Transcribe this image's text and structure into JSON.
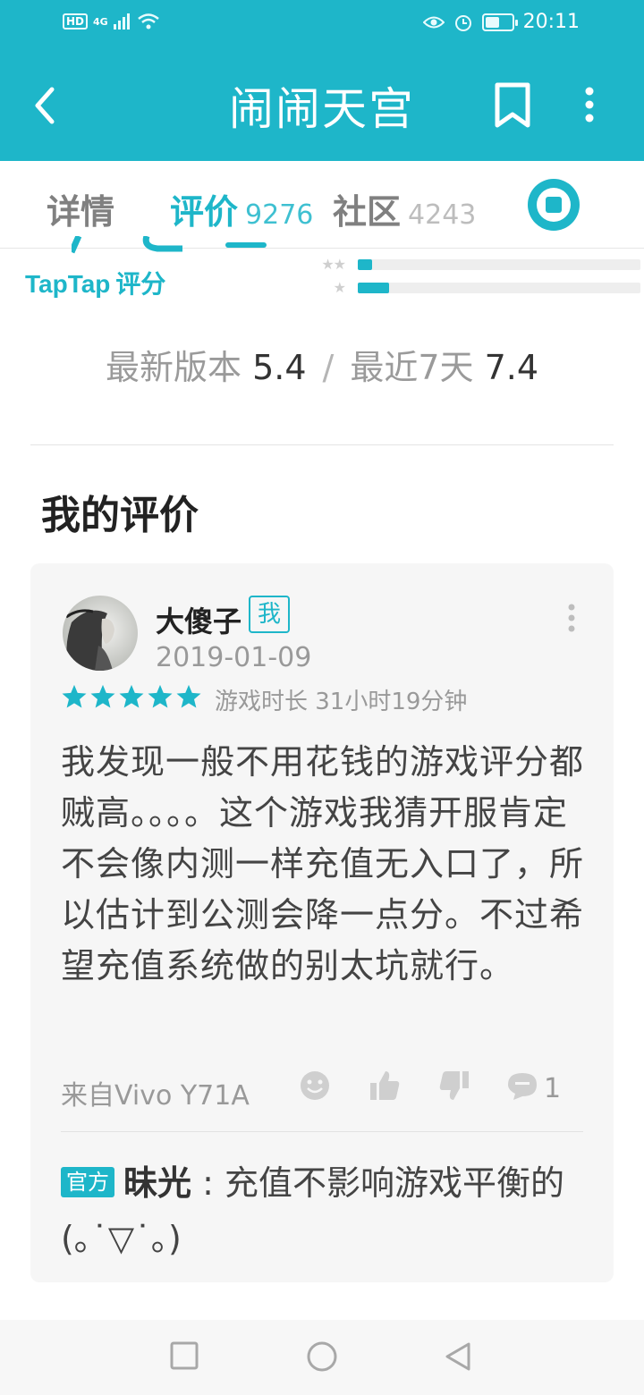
{
  "status_bar": {
    "hd_label": "HD",
    "network_label": "4G",
    "time": "20:11",
    "battery_level": 0.55
  },
  "header": {
    "title": "闹闹天宫",
    "back_icon": "chevron-left-icon",
    "bookmark_icon": "bookmark-icon",
    "more_icon": "vertical-dots-icon"
  },
  "tabs": [
    {
      "label": "详情",
      "count": "",
      "active": false
    },
    {
      "label": "评价",
      "count": "9276",
      "active": true
    },
    {
      "label": "社区",
      "count": "4243",
      "active": false
    }
  ],
  "rating": {
    "brand": "TapTap",
    "brand_suffix": "评分",
    "bars": [
      {
        "stars": "★★",
        "fraction": 0.05
      },
      {
        "stars": "★",
        "fraction": 0.11
      }
    ],
    "latest_version_label": "最新版本",
    "latest_version_score": "5.4",
    "separator": "/",
    "recent_label": "最近7天",
    "recent_score": "7.4"
  },
  "my_review": {
    "section_title": "我的评价",
    "user_name": "大傻子",
    "me_tag": "我",
    "date": "2019-01-09",
    "stars": 5,
    "playtime": "游戏时长 31小时19分钟",
    "text": "我发现一般不用花钱的游戏评分都贼高。。。。这个游戏我猜开服肯定不会像内测一样充值无入口了，所以估计到公测会降一点分。不过希望充值系统做的别太坑就行。",
    "device": "来自Vivo Y71A",
    "reply_count": "1",
    "official_tag": "官方",
    "reply_name": "昧光",
    "reply_text": " : 充值不影响游戏平衡的(｡˙▽˙｡)"
  },
  "colors": {
    "accent": "#1eb6c9",
    "card_bg": "#f6f6f6"
  }
}
